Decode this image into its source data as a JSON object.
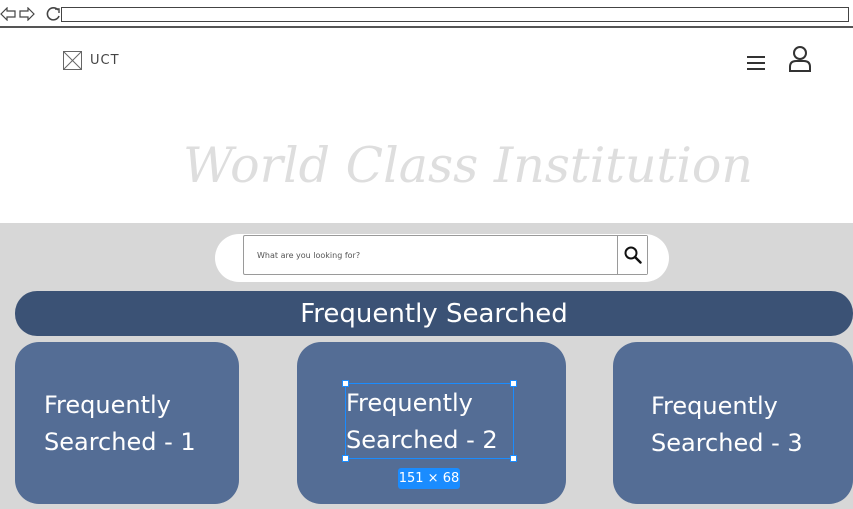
{
  "browser": {
    "back_icon": "arrow-left-icon",
    "forward_icon": "arrow-right-icon",
    "reload_icon": "reload-icon",
    "url": ""
  },
  "header": {
    "logo_image_icon": "image-placeholder-icon",
    "logo_text": "UCT",
    "menu_icon": "hamburger-icon",
    "user_icon": "user-icon"
  },
  "hero": {
    "title": "World Class Institution"
  },
  "search": {
    "placeholder": "What are you looking for?",
    "button_icon": "search-icon"
  },
  "section": {
    "title": "Frequently Searched"
  },
  "cards": [
    {
      "line1": "Frequently",
      "line2": "Searched - 1"
    },
    {
      "line1": "Frequently",
      "line2": "Searched - 2"
    },
    {
      "line1": "Frequently",
      "line2": "Searched - 3"
    }
  ],
  "selection": {
    "size_label": "151 × 68"
  },
  "colors": {
    "header_bar": "#3b5275",
    "card": "#546d95",
    "band": "#d7d7d7",
    "selection": "#1a8cff"
  }
}
